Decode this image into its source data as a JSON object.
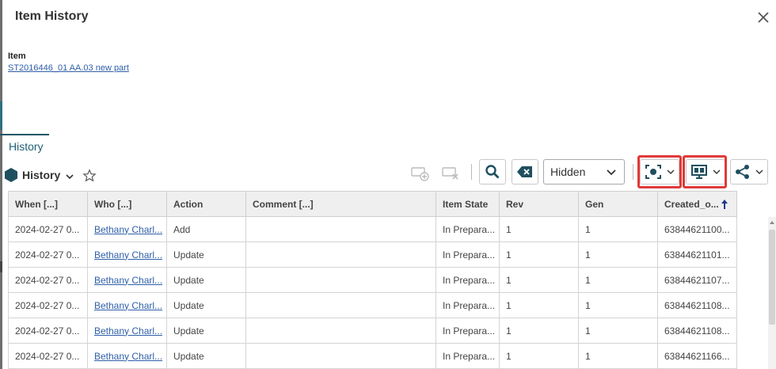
{
  "dialog": {
    "title": "Item History",
    "close_icon": "close-icon"
  },
  "item": {
    "label": "Item",
    "link_text": "ST2016446_01 AA.03 new part"
  },
  "tabs": [
    {
      "label": "History",
      "active": true
    }
  ],
  "view": {
    "title": "History",
    "icon": "hexagon-icon"
  },
  "toolbar": {
    "hidden_select": {
      "value": "Hidden"
    },
    "icons": [
      "add-row-icon",
      "remove-row-icon",
      "search-icon",
      "clear-filter-icon",
      "camera-capture-icon",
      "display-icon",
      "share-icon"
    ],
    "highlight_color": "#e03a3a"
  },
  "grid": {
    "columns": [
      "When [...]",
      "Who [...]",
      "Action",
      "Comment [...]",
      "Item State",
      "Rev",
      "Gen",
      "Created_o..."
    ],
    "rows": [
      [
        "2024-02-27 0...",
        "Bethany Charl...",
        "Add",
        "",
        "In Prepara...",
        "1",
        "1",
        "63844621100..."
      ],
      [
        "2024-02-27 0...",
        "Bethany Charl...",
        "Update",
        "",
        "In Prepara...",
        "1",
        "1",
        "63844621101..."
      ],
      [
        "2024-02-27 0...",
        "Bethany Charl...",
        "Update",
        "",
        "In Prepara...",
        "1",
        "1",
        "63844621107..."
      ],
      [
        "2024-02-27 0...",
        "Bethany Charl...",
        "Update",
        "",
        "In Prepara...",
        "1",
        "1",
        "63844621108..."
      ],
      [
        "2024-02-27 0...",
        "Bethany Charl...",
        "Update",
        "",
        "In Prepara...",
        "1",
        "1",
        "63844621108..."
      ],
      [
        "2024-02-27 0...",
        "Bethany Charl...",
        "Update",
        "",
        "In Prepara...",
        "1",
        "1",
        "63844621166..."
      ]
    ]
  }
}
